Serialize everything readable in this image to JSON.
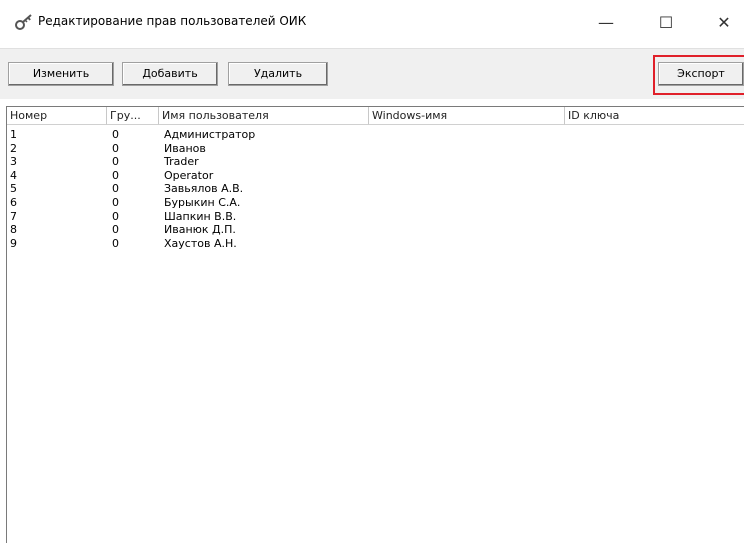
{
  "window": {
    "title": "Редактирование прав пользователей ОИК",
    "minimize_glyph": "—",
    "maximize_glyph": "☐",
    "close_glyph": "✕"
  },
  "toolbar": {
    "edit_label": "Изменить",
    "add_label": "Добавить",
    "delete_label": "Удалить",
    "export_label": "Экспорт"
  },
  "table": {
    "columns": [
      "Номер",
      "Гру...",
      "Имя пользователя",
      "Windows-имя",
      "ID ключа"
    ],
    "rows": [
      [
        "1",
        "0",
        "Администратор"
      ],
      [
        "2",
        "0",
        "Иванов"
      ],
      [
        "3",
        "0",
        "Trader"
      ],
      [
        "4",
        "0",
        "Operator"
      ],
      [
        "5",
        "0",
        "Завьялов А.В."
      ],
      [
        "6",
        "0",
        "Бурыкин С.А."
      ],
      [
        "7",
        "0",
        "Шапкин В.В."
      ],
      [
        "8",
        "0",
        "Иванюк Д.П."
      ],
      [
        "9",
        "0",
        "Хаустов А.Н."
      ]
    ]
  },
  "colors": {
    "highlight": "#e0202a"
  }
}
